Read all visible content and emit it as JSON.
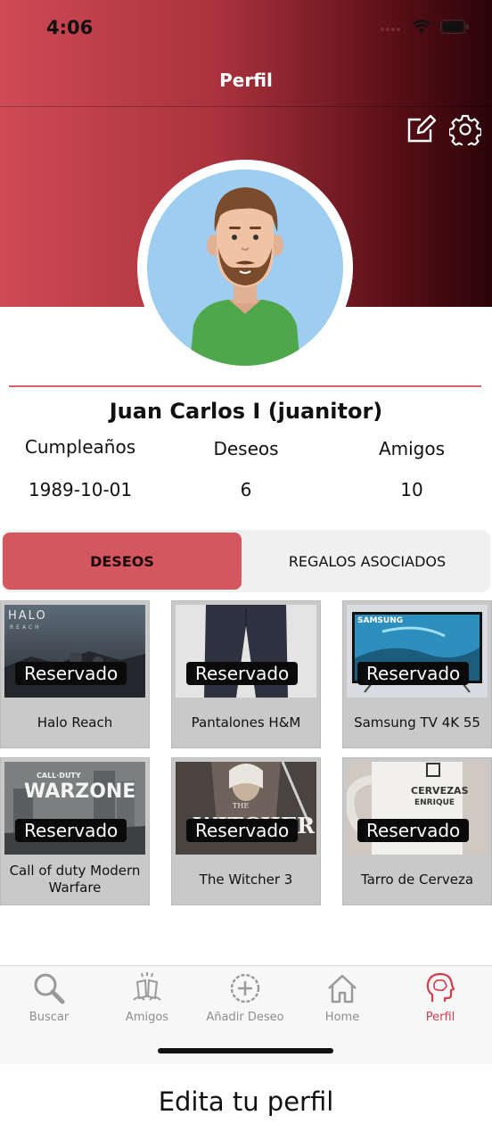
{
  "status_bar": {
    "time": "4:06"
  },
  "nav": {
    "title": "Perfil",
    "edit_icon": "edit-icon",
    "settings_icon": "gear-icon"
  },
  "profile": {
    "name": "Juan Carlos I (juanitor)",
    "stats": [
      {
        "label": "Cumpleaños",
        "value": "1989-10-01"
      },
      {
        "label": "Deseos",
        "value": "6"
      },
      {
        "label": "Amigos",
        "value": "10"
      }
    ]
  },
  "tabs": [
    {
      "label": "DESEOS",
      "active": true
    },
    {
      "label": "REGALOS ASOCIADOS",
      "active": false
    }
  ],
  "wishes": [
    {
      "title": "Halo Reach",
      "badge": "Reservado",
      "image_text": "HALO\nREACH"
    },
    {
      "title": "Pantalones H&M",
      "badge": "Reservado",
      "image_text": ""
    },
    {
      "title": "Samsung TV 4K 55",
      "badge": "Reservado",
      "image_text": "SAMSUNG"
    },
    {
      "title": "Call of duty Modern Warfare",
      "badge": "Reservado",
      "image_text": "CALL·DUTY WARZONE"
    },
    {
      "title": "The Witcher 3",
      "badge": "Reservado",
      "image_text": "THE WITCHER"
    },
    {
      "title": "Tarro de Cerveza",
      "badge": "Reservado",
      "image_text": "CERVEZAS ENRIQUE"
    }
  ],
  "tabbar": [
    {
      "label": "Buscar",
      "icon": "search-icon",
      "active": false
    },
    {
      "label": "Amigos",
      "icon": "cheers-icon",
      "active": false
    },
    {
      "label": "Añadir Deseo",
      "icon": "add-circle-icon",
      "active": false
    },
    {
      "label": "Home",
      "icon": "home-icon",
      "active": false
    },
    {
      "label": "Perfil",
      "icon": "profile-head-icon",
      "active": true
    }
  ],
  "caption": "Edita tu perfil",
  "colors": {
    "accent": "#d4565f",
    "header_start": "#cf4a55",
    "header_end": "#2a0408",
    "active_tab_label": "#d43d4a"
  }
}
